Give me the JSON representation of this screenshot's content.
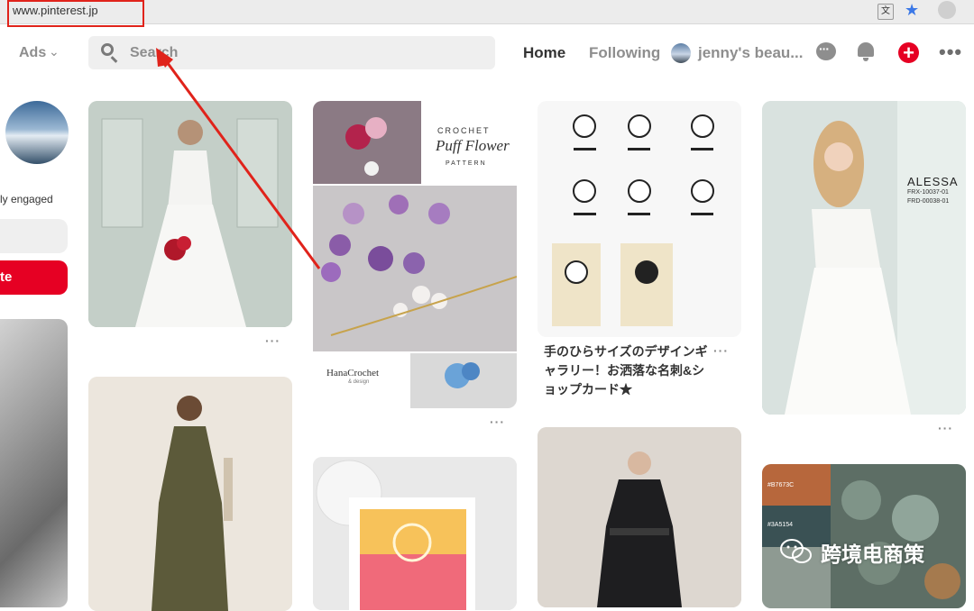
{
  "browser": {
    "url": "www.pinterest.jp",
    "translate_icon": "translate-icon",
    "bookmark_icon": "star-icon",
    "profile_icon": "profile-icon",
    "annotation_color": "#e0231b"
  },
  "header": {
    "ads_label": "Ads",
    "search_placeholder": "Search",
    "nav_home": "Home",
    "nav_following": "Following",
    "nav_profile": "jenny's beau...",
    "icons": [
      "chat-icon",
      "bell-icon",
      "add-icon",
      "more-icon"
    ],
    "accent_color": "#e60023"
  },
  "left_column": {
    "engaged_text": "ly engaged",
    "red_button_label": "te"
  },
  "pins": {
    "wedding_more": "···",
    "crochet_title_1": "CROCHET",
    "crochet_title_2": "Puff Flower",
    "crochet_title_3": "PATTERN",
    "crochet_brand": "HanaCrochet",
    "crochet_brand_sub": "& design",
    "crochet_more": "···",
    "cards_caption": "手のひらサイズのデザインギャラリー！お洒落な名刺&ショップカード★",
    "cards_more": "···",
    "alessa_name": "ALESSA",
    "alessa_code_1": "FRX-10037-01",
    "alessa_code_2": "FRD-00038-01",
    "alessa_more": "···",
    "palette_code_1": "#B7673C",
    "palette_code_2": "#3A5154"
  },
  "watermark": {
    "text": "跨境电商策",
    "icon": "wechat-icon"
  }
}
